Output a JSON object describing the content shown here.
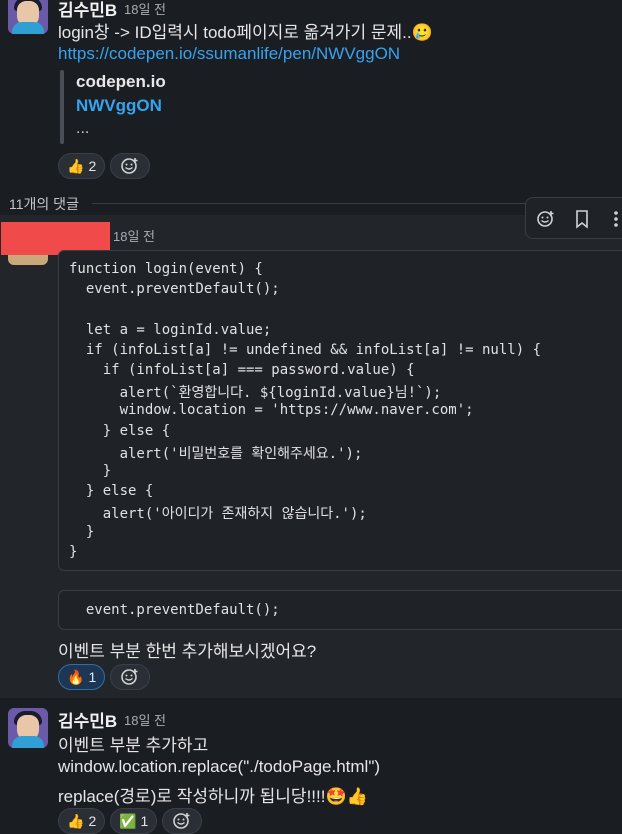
{
  "post": {
    "author": "김수민B",
    "time": "18일 전",
    "text": "login창 -> ID입력시 todo페이지로 옮겨가기 문제..🥲",
    "link": "https://codepen.io/ssumanlife/pen/NWVggON",
    "preview": {
      "site": "codepen.io",
      "title": "NWVggON",
      "desc": "..."
    },
    "reactions": [
      {
        "emoji": "👍",
        "count": "2"
      }
    ]
  },
  "thread": {
    "count_label": "11개의 댓글"
  },
  "reply1": {
    "time": "18일 전",
    "code_lines": [
      "function login(event) {",
      "  event.preventDefault();",
      "",
      "  let a = loginId.value;",
      "  if (infoList[a] != undefined && infoList[a] != null) {",
      "    if (infoList[a] === password.value) {",
      "      alert(`환영합니다. ${loginId.value}님!`);",
      "      window.location = 'https://www.naver.com';",
      "    } else {",
      "      alert('비밀번호를 확인해주세요.');",
      "    }",
      "  } else {",
      "    alert('아이디가 존재하지 않습니다.');",
      "  }",
      "}"
    ],
    "code2": "  event.preventDefault();",
    "text": "이벤트 부분 한번 추가해보시겠어요?",
    "reactions": [
      {
        "emoji": "🔥",
        "count": "1"
      }
    ]
  },
  "reply2": {
    "author": "김수민B",
    "time": "18일 전",
    "lines": [
      "이벤트 부분 추가하고",
      "window.location.replace(\"./todoPage.html\")",
      "replace(경로)로 작성하니까 됩니당!!!!🤩👍"
    ],
    "reactions": [
      {
        "emoji": "👍",
        "count": "2"
      },
      {
        "emoji": "✅",
        "count": "1"
      }
    ]
  },
  "colors": {
    "background": "#1a1d21",
    "link": "#36a3f0",
    "redacted": "#f04a4a"
  }
}
